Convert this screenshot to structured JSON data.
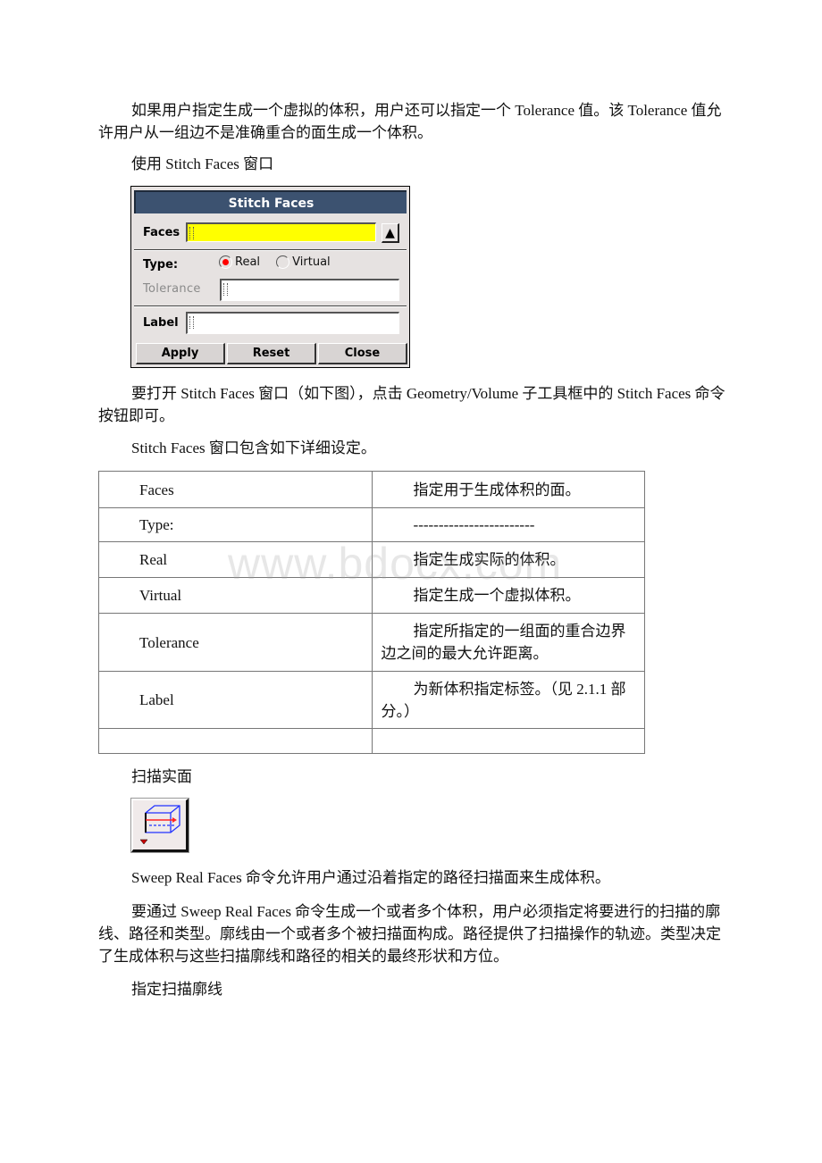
{
  "paragraphs": {
    "p1": "如果用户指定生成一个虚拟的体积，用户还可以指定一个 Tolerance 值。该 Tolerance 值允许用户从一组边不是准确重合的面生成一个体积。",
    "p2": "使用 Stitch Faces 窗口",
    "p3": "要打开 Stitch Faces 窗口（如下图），点击 Geometry/Volume 子工具框中的 Stitch Faces 命令按钮即可。",
    "p4": "Stitch Faces 窗口包含如下详细设定。",
    "p5": "扫描实面",
    "p6": "Sweep Real Faces 命令允许用户通过沿着指定的路径扫描面来生成体积。",
    "p7": "要通过 Sweep Real Faces 命令生成一个或者多个体积，用户必须指定将要进行的扫描的廓线、路径和类型。廓线由一个或者多个被扫描面构成。路径提供了扫描操作的轨迹。类型决定了生成体积与这些扫描廓线和路径的相关的最终形状和方位。",
    "p8": "指定扫描廓线"
  },
  "dialog": {
    "title": "Stitch Faces",
    "faces_label": "Faces",
    "faces_value": "",
    "type_label": "Type:",
    "radio_real": "Real",
    "radio_virtual": "Virtual",
    "selected_type": "Real",
    "tolerance_label": "Tolerance",
    "tolerance_value": "",
    "label_label": "Label",
    "label_value": "",
    "apply": "Apply",
    "reset": "Reset",
    "close": "Close",
    "field_color": "#ffff00",
    "title_bg": "#3c5270"
  },
  "table": {
    "rows": [
      {
        "name": "Faces",
        "desc": "指定用于生成体积的面。"
      },
      {
        "name": "Type:",
        "desc": "------------------------"
      },
      {
        "name": "Real",
        "desc": "指定生成实际的体积。"
      },
      {
        "name": "Virtual",
        "desc": "指定生成一个虚拟体积。"
      },
      {
        "name": "Tolerance",
        "desc": "指定所指定的一组面的重合边界边之间的最大允许距离。"
      },
      {
        "name": "Label",
        "desc": "为新体积指定标签。（见 2.1.1 部分。）"
      },
      {
        "name": "",
        "desc": ""
      }
    ]
  },
  "watermark": "www.bdocx.com",
  "icons": {
    "sweep_tool": "sweep-real-faces-icon"
  }
}
